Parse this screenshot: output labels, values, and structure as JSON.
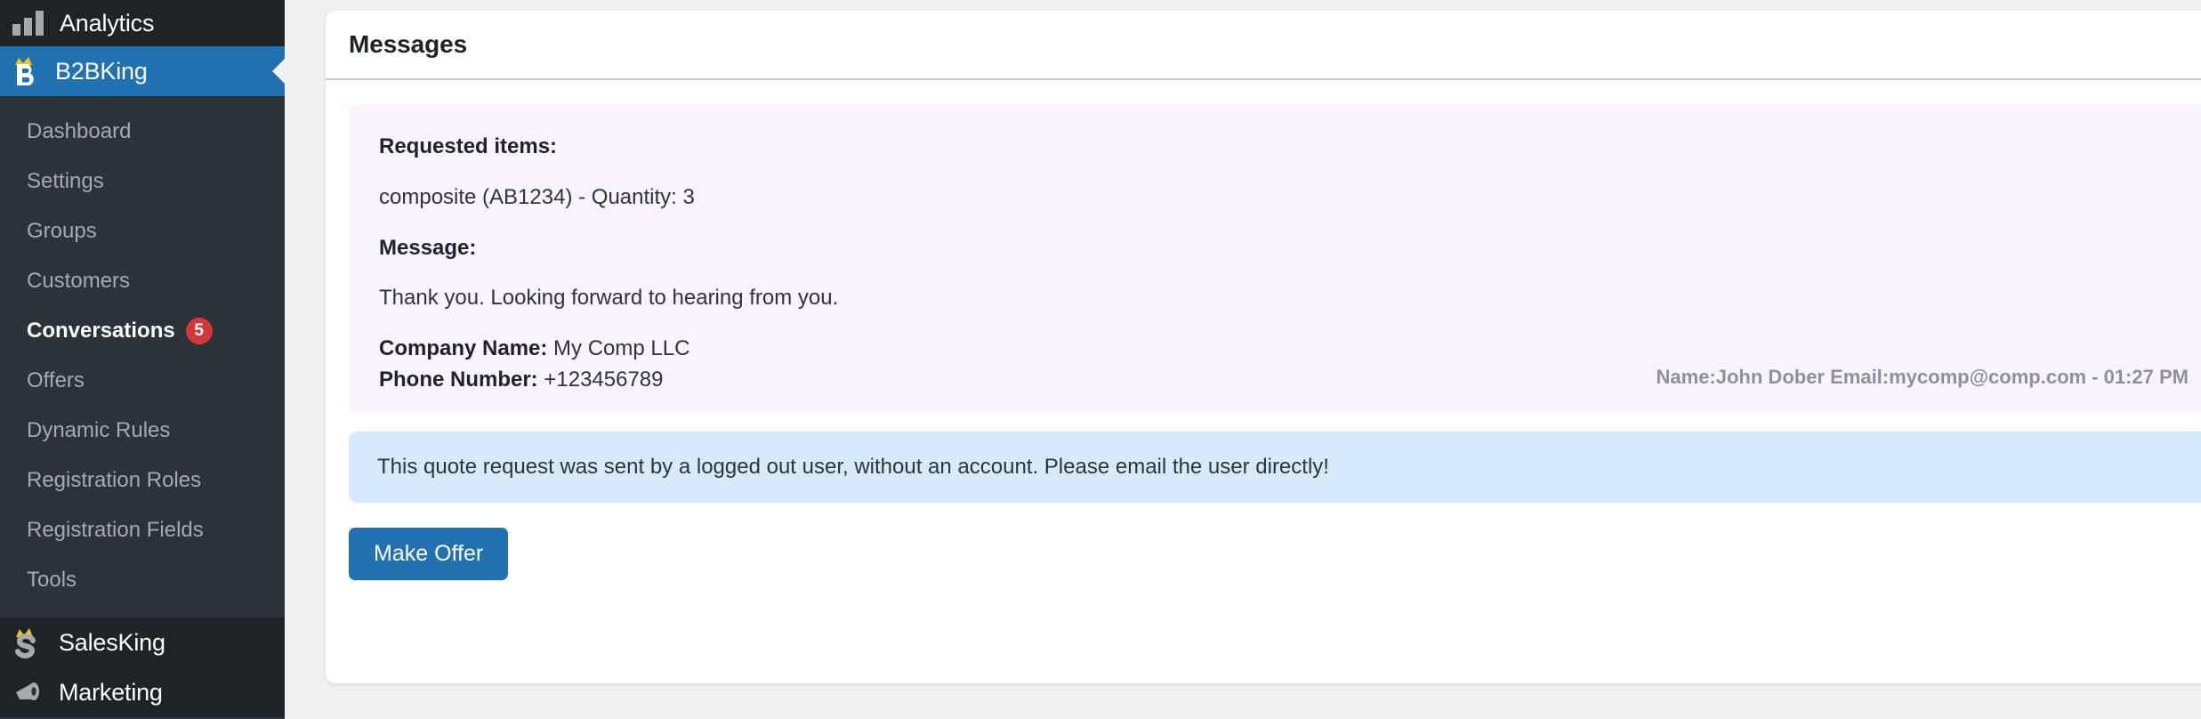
{
  "sidebar": {
    "top_menu": {
      "label": "Analytics",
      "icon": "bar-chart-icon"
    },
    "current_menu": {
      "label": "B2BKing",
      "icon": "b2bking-crown-b-icon",
      "accent_color": "#2271b1"
    },
    "submenu": [
      {
        "label": "Dashboard",
        "active": false
      },
      {
        "label": "Settings",
        "active": false
      },
      {
        "label": "Groups",
        "active": false
      },
      {
        "label": "Customers",
        "active": false
      },
      {
        "label": "Conversations",
        "active": true,
        "badge": "5"
      },
      {
        "label": "Offers",
        "active": false
      },
      {
        "label": "Dynamic Rules",
        "active": false
      },
      {
        "label": "Registration Roles",
        "active": false
      },
      {
        "label": "Registration Fields",
        "active": false
      },
      {
        "label": "Tools",
        "active": false
      }
    ],
    "plugins": [
      {
        "label": "SalesKing",
        "icon": "salesking-crown-s-icon"
      },
      {
        "label": "Marketing",
        "icon": "megaphone-icon"
      }
    ],
    "colors": {
      "background": "#2c3338",
      "header_background": "#1d2327",
      "active_background": "#2271b1",
      "badge_background": "#d63638",
      "text": "#a7aaad",
      "text_active": "#ffffff"
    }
  },
  "main": {
    "card_title": "Messages",
    "message": {
      "requested_items_label": "Requested items:",
      "requested_items_value": "composite (AB1234) - Quantity: 3",
      "message_label": "Message:",
      "message_body": "Thank you. Looking forward to hearing from you.",
      "company_name_label": "Company Name:",
      "company_name_value": "My Comp LLC",
      "phone_number_label": "Phone Number:",
      "phone_number_value": "+123456789",
      "signature": "Name:John Dober Email:mycomp@comp.com - 01:27 PM",
      "bubble_color": "#f8f3fd"
    },
    "alert": {
      "text": "This quote request was sent by a logged out user, without an account. Please email the user directly!",
      "background_color": "#d6eafb"
    },
    "make_offer_button": {
      "label": "Make Offer",
      "color": "#2271b1"
    }
  }
}
